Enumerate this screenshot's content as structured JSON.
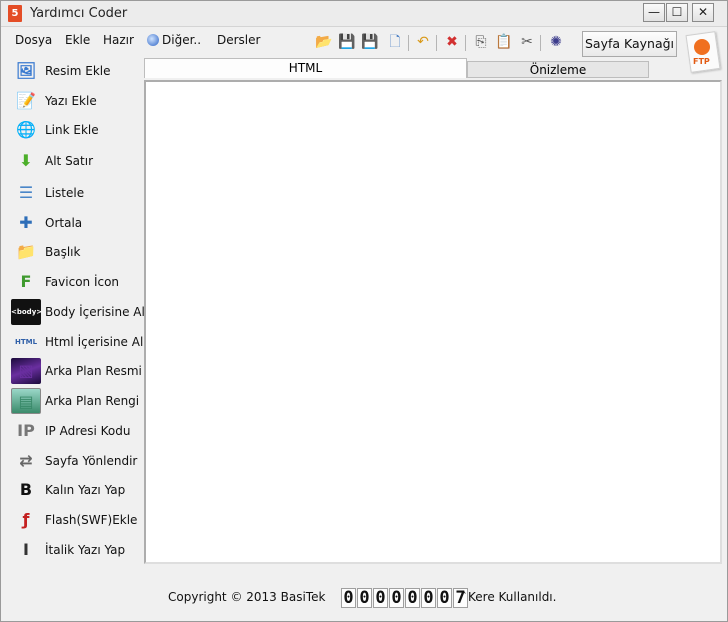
{
  "window": {
    "title": "Yardımcı Coder",
    "app_icon_glyph": "5"
  },
  "window_controls": {
    "minimize": "—",
    "maximize": "☐",
    "close": "✕"
  },
  "menu": {
    "items": [
      {
        "label": "Dosya"
      },
      {
        "label": "Ekle"
      },
      {
        "label": "Hazır"
      },
      {
        "label": "Diğer..",
        "icon": "globe-icon"
      },
      {
        "label": "Dersler"
      }
    ]
  },
  "toolbar": {
    "buttons": [
      {
        "name": "open-folder-icon",
        "glyph": "📂",
        "color": "#d8a02a"
      },
      {
        "name": "save-icon",
        "glyph": "💾",
        "color": "#2c2c2c"
      },
      {
        "name": "save-as-icon",
        "glyph": "💾",
        "color": "#2c2c2c"
      },
      {
        "name": "new-page-icon",
        "glyph": "🗋",
        "color": "#4a7fc4"
      },
      {
        "name": "undo-icon",
        "glyph": "↶",
        "color": "#d99a1a"
      },
      {
        "name": "delete-icon",
        "glyph": "✖",
        "color": "#d23030"
      },
      {
        "name": "copy-icon",
        "glyph": "⎘",
        "color": "#555555"
      },
      {
        "name": "paste-icon",
        "glyph": "📋",
        "color": "#b07d2a"
      },
      {
        "name": "cut-icon",
        "glyph": "✂",
        "color": "#555555"
      },
      {
        "name": "color-picker-icon",
        "glyph": "✺",
        "color": "#3c3c8c"
      }
    ],
    "source_button": "Sayfa Kaynağı",
    "ftp_label": "FTP"
  },
  "sidebar": {
    "items": [
      {
        "label": "Resim Ekle",
        "icon": "image-icon",
        "color": "#3b7bd0"
      },
      {
        "label": "Yazı Ekle",
        "icon": "notepad-icon",
        "color": "#2a5fa8"
      },
      {
        "label": "Link Ekle",
        "icon": "globe-icon",
        "color": "#2f8a3b"
      },
      {
        "label": "Alt Satır",
        "icon": "arrow-down-icon",
        "color": "#4caf2a"
      },
      {
        "label": "Listele",
        "icon": "list-icon",
        "color": "#4a86c8"
      },
      {
        "label": "Ortala",
        "icon": "align-center-icon",
        "color": "#2e6eb8"
      },
      {
        "label": "Başlık",
        "icon": "folder-icon",
        "color": "#5e6b7a"
      },
      {
        "label": "Favicon İcon",
        "icon": "favicon-icon",
        "color": "#3f9a2e"
      },
      {
        "label": "Body İçerisine Al",
        "icon": "body-tag-icon",
        "color": "#111111"
      },
      {
        "label": "Html İçerisine Al",
        "icon": "html-tag-icon",
        "color": "#2f5fa8"
      },
      {
        "label": "Arka Plan Resmi",
        "icon": "background-image-icon",
        "color": "#6a2fa0"
      },
      {
        "label": "Arka Plan Rengi",
        "icon": "background-color-icon",
        "color": "#3a8a6a"
      },
      {
        "label": "IP Adresi Kodu",
        "icon": "ip-address-icon",
        "color": "#777777"
      },
      {
        "label": "Sayfa Yönlendir",
        "icon": "redirect-icon",
        "color": "#666666"
      },
      {
        "label": "Kalın Yazı Yap",
        "icon": "bold-icon",
        "color": "#111111"
      },
      {
        "label": "Flash(SWF)Ekle",
        "icon": "flash-icon",
        "color": "#c42020"
      },
      {
        "label": "İtalik Yazı Yap",
        "icon": "italic-icon",
        "color": "#333333"
      }
    ],
    "icon_glyphs": [
      "🖼",
      "📝",
      "🌐",
      "⬇",
      "☰",
      "✚",
      "📁",
      "F",
      "<body>",
      "HTML",
      "▧",
      "▤",
      "IP",
      "⇄",
      "B",
      "ƒ",
      "I"
    ]
  },
  "tabs": [
    {
      "label": "HTML",
      "active": true
    },
    {
      "label": "Önizleme",
      "active": false
    }
  ],
  "editor": {
    "value": ""
  },
  "footer": {
    "copyright": "Copyright © 2013 BasiTek",
    "counter_digits": [
      "0",
      "0",
      "0",
      "0",
      "0",
      "0",
      "0",
      "7"
    ],
    "counter_suffix": "`Kere Kullanıldı."
  }
}
